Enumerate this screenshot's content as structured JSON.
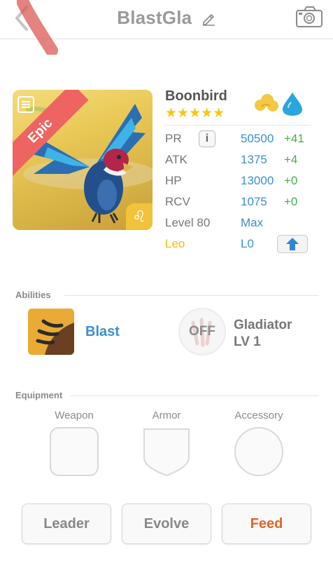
{
  "header": {
    "title": "BlastGla"
  },
  "card": {
    "rarity": "Epic",
    "zodiac_symbol": "♌"
  },
  "monster": {
    "name": "Boonbird",
    "stars": "★★★★★",
    "stats": [
      {
        "label": "PR",
        "value": "50500",
        "bonus": "+41"
      },
      {
        "label": "ATK",
        "value": "1375",
        "bonus": "+4"
      },
      {
        "label": "HP",
        "value": "13000",
        "bonus": "+0"
      },
      {
        "label": "RCV",
        "value": "1075",
        "bonus": "+0"
      }
    ],
    "level_label": "Level 80",
    "level_value": "Max",
    "zodiac_label": "Leo",
    "zodiac_level": "L0",
    "info_glyph": "i"
  },
  "abilities": {
    "section_title": "Abilities",
    "active_name": "Blast",
    "passive_state": "OFF",
    "passive_name_line1": "Gladiator",
    "passive_name_line2": "LV 1"
  },
  "equipment": {
    "section_title": "Equipment",
    "slots": [
      "Weapon",
      "Armor",
      "Accessory"
    ]
  },
  "buttons": {
    "leader": "Leader",
    "evolve": "Evolve",
    "feed": "Feed"
  },
  "colors": {
    "accent_blue": "#3b8fd1",
    "bonus_green": "#48ad48",
    "epic_red": "#ee6463",
    "star_gold": "#f7c713",
    "feed_orange": "#e56425"
  }
}
